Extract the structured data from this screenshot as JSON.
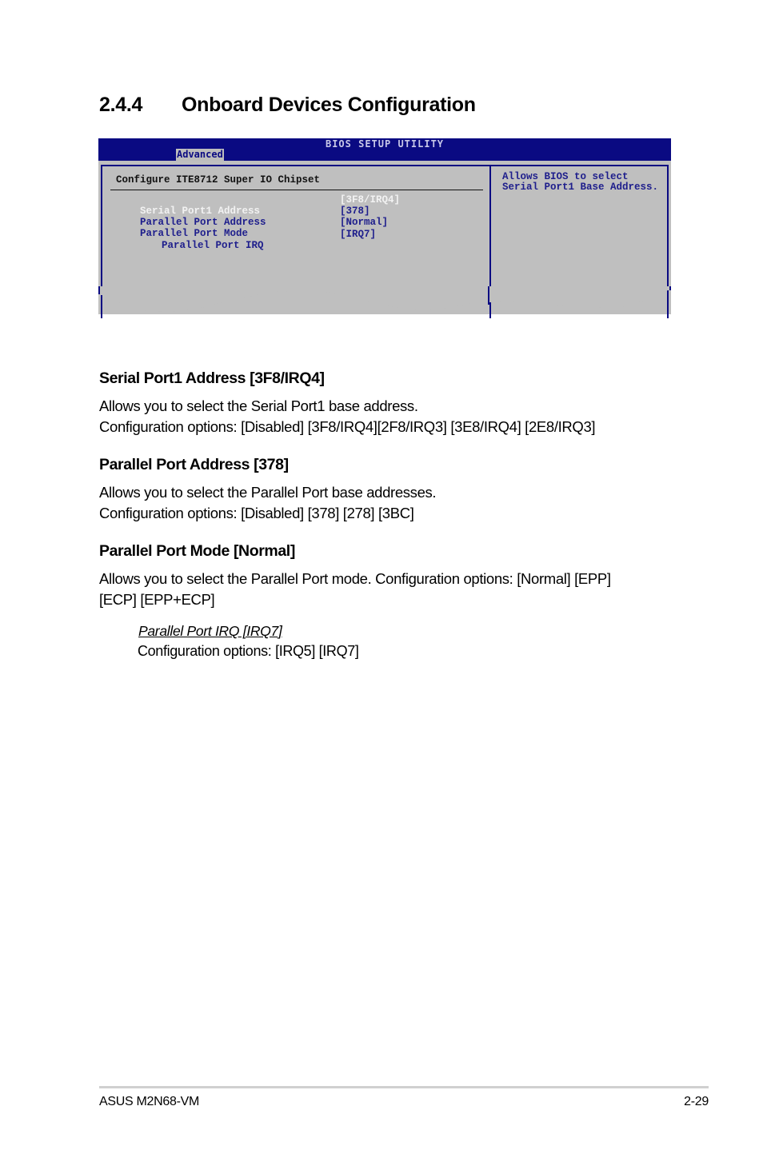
{
  "section": {
    "number": "2.4.4",
    "title": "Onboard Devices Configuration"
  },
  "bios": {
    "title": "BIOS SETUP UTILITY",
    "active_tab": "Advanced",
    "config_title": "Configure ITE8712 Super IO Chipset",
    "items": [
      {
        "label": "Serial Port1 Address",
        "value": "[3F8/IRQ4]",
        "selected": true,
        "indent": false
      },
      {
        "label": "Parallel Port Address",
        "value": "[378]",
        "selected": false,
        "indent": false
      },
      {
        "label": "Parallel Port Mode",
        "value": "[Normal]",
        "selected": false,
        "indent": false
      },
      {
        "label": "Parallel Port IRQ",
        "value": "[IRQ7]",
        "selected": false,
        "indent": true
      }
    ],
    "help_text": "Allows BIOS to select Serial Port1 Base Address.",
    "colors": {
      "bar": "#0a0a82",
      "panel": "#bfbfbf",
      "item_text": "#1e1e8c",
      "selected_text": "#f2f2f2"
    }
  },
  "content": {
    "serial_port": {
      "heading": "Serial Port1 Address [3F8/IRQ4]",
      "line1": "Allows you to select the Serial Port1 base address.",
      "line2": "Configuration options: [Disabled] [3F8/IRQ4][2F8/IRQ3] [3E8/IRQ4] [2E8/IRQ3]"
    },
    "parallel_address": {
      "heading": "Parallel Port Address [378]",
      "line1": "Allows you to select the Parallel Port base addresses.",
      "line2": "Configuration options: [Disabled] [378] [278] [3BC]"
    },
    "parallel_mode": {
      "heading": "Parallel Port Mode [Normal]",
      "line1": "Allows you to select the Parallel Port  mode. Configuration options: [Normal] [EPP]",
      "line2": "[ECP] [EPP+ECP]"
    },
    "parallel_irq": {
      "heading": "Parallel Port IRQ [IRQ7]",
      "line1": "Configuration options: [IRQ5] [IRQ7]"
    }
  },
  "footer": {
    "product": "ASUS M2N68-VM",
    "page": "2-29"
  }
}
